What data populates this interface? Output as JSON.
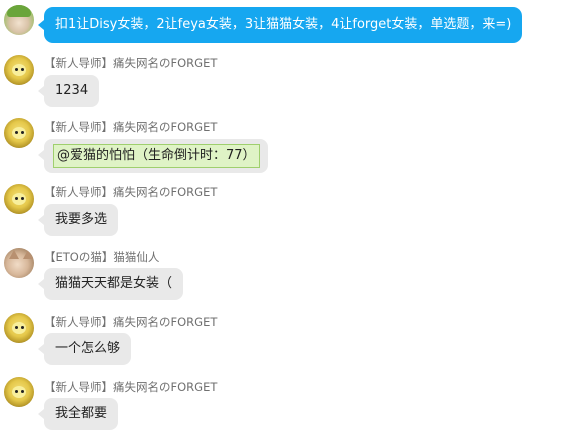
{
  "messages": [
    {
      "sender": "",
      "avatar_icon": "green-hat-avatar-icon",
      "text": "扣1让Disy女装，2让feya女装，3让猫猫女装，4让forget女装，单选题，来=)"
    },
    {
      "sender": "【新人导师】痛失网名のFORGET",
      "avatar_icon": "yellow-avatar-icon",
      "text": "1234"
    },
    {
      "sender": "【新人导师】痛失网名のFORGET",
      "avatar_icon": "yellow-avatar-icon",
      "mention": "@爱猫的怕怕（生命倒计时：77）"
    },
    {
      "sender": "【新人导师】痛失网名のFORGET",
      "avatar_icon": "yellow-avatar-icon",
      "text": "我要多选"
    },
    {
      "sender": "【ETOの猫】猫猫仙人",
      "avatar_icon": "cat-avatar-icon",
      "text": "猫猫天天都是女装（"
    },
    {
      "sender": "【新人导师】痛失网名のFORGET",
      "avatar_icon": "yellow-avatar-icon",
      "text": "一个怎么够"
    },
    {
      "sender": "【新人导师】痛失网名のFORGET",
      "avatar_icon": "yellow-avatar-icon",
      "text": "我全都要"
    }
  ],
  "colors": {
    "outgoing_bubble": "#16a7f0",
    "incoming_bubble": "#e9e9e9",
    "mention_bg": "#dff3c6",
    "sender_name": "#707070"
  }
}
